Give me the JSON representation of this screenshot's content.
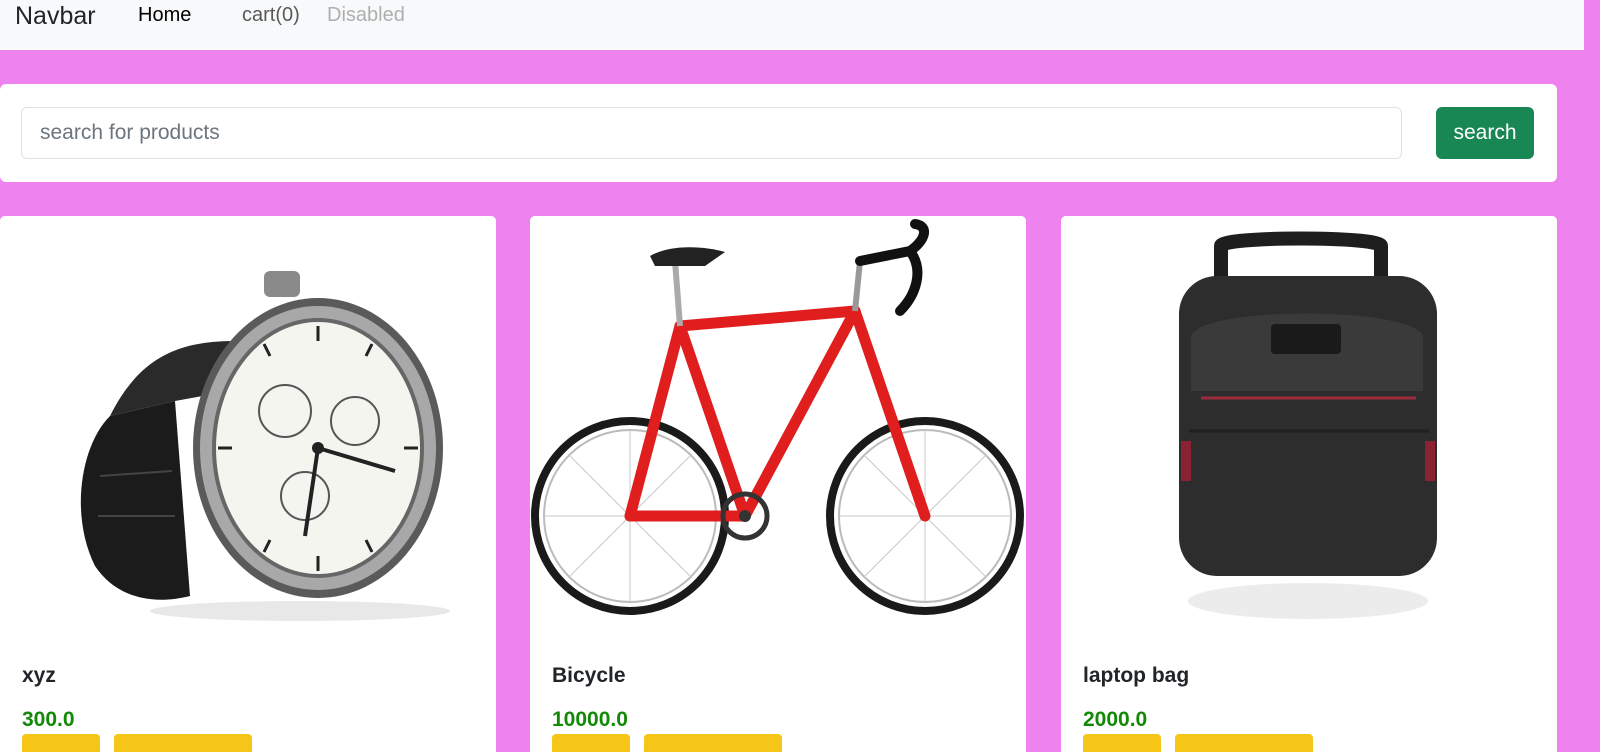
{
  "navbar": {
    "brand": "Navbar",
    "links": [
      {
        "label": "Home"
      },
      {
        "label": "cart(0)"
      },
      {
        "label": "Disabled"
      }
    ]
  },
  "search": {
    "placeholder": "search for products",
    "button_label": "search"
  },
  "products": [
    {
      "name": "xyz",
      "price": "300.0",
      "image": "wristwatch"
    },
    {
      "name": "Bicycle",
      "price": "10000.0",
      "image": "red-road-bicycle"
    },
    {
      "name": "laptop bag",
      "price": "2000.0",
      "image": "black-backpack"
    }
  ],
  "colors": {
    "page_background": "#ee82ee",
    "navbar_background": "#f8f9fa",
    "search_button": "#198754",
    "price": "#138a07",
    "card_button": "#f5c518"
  }
}
